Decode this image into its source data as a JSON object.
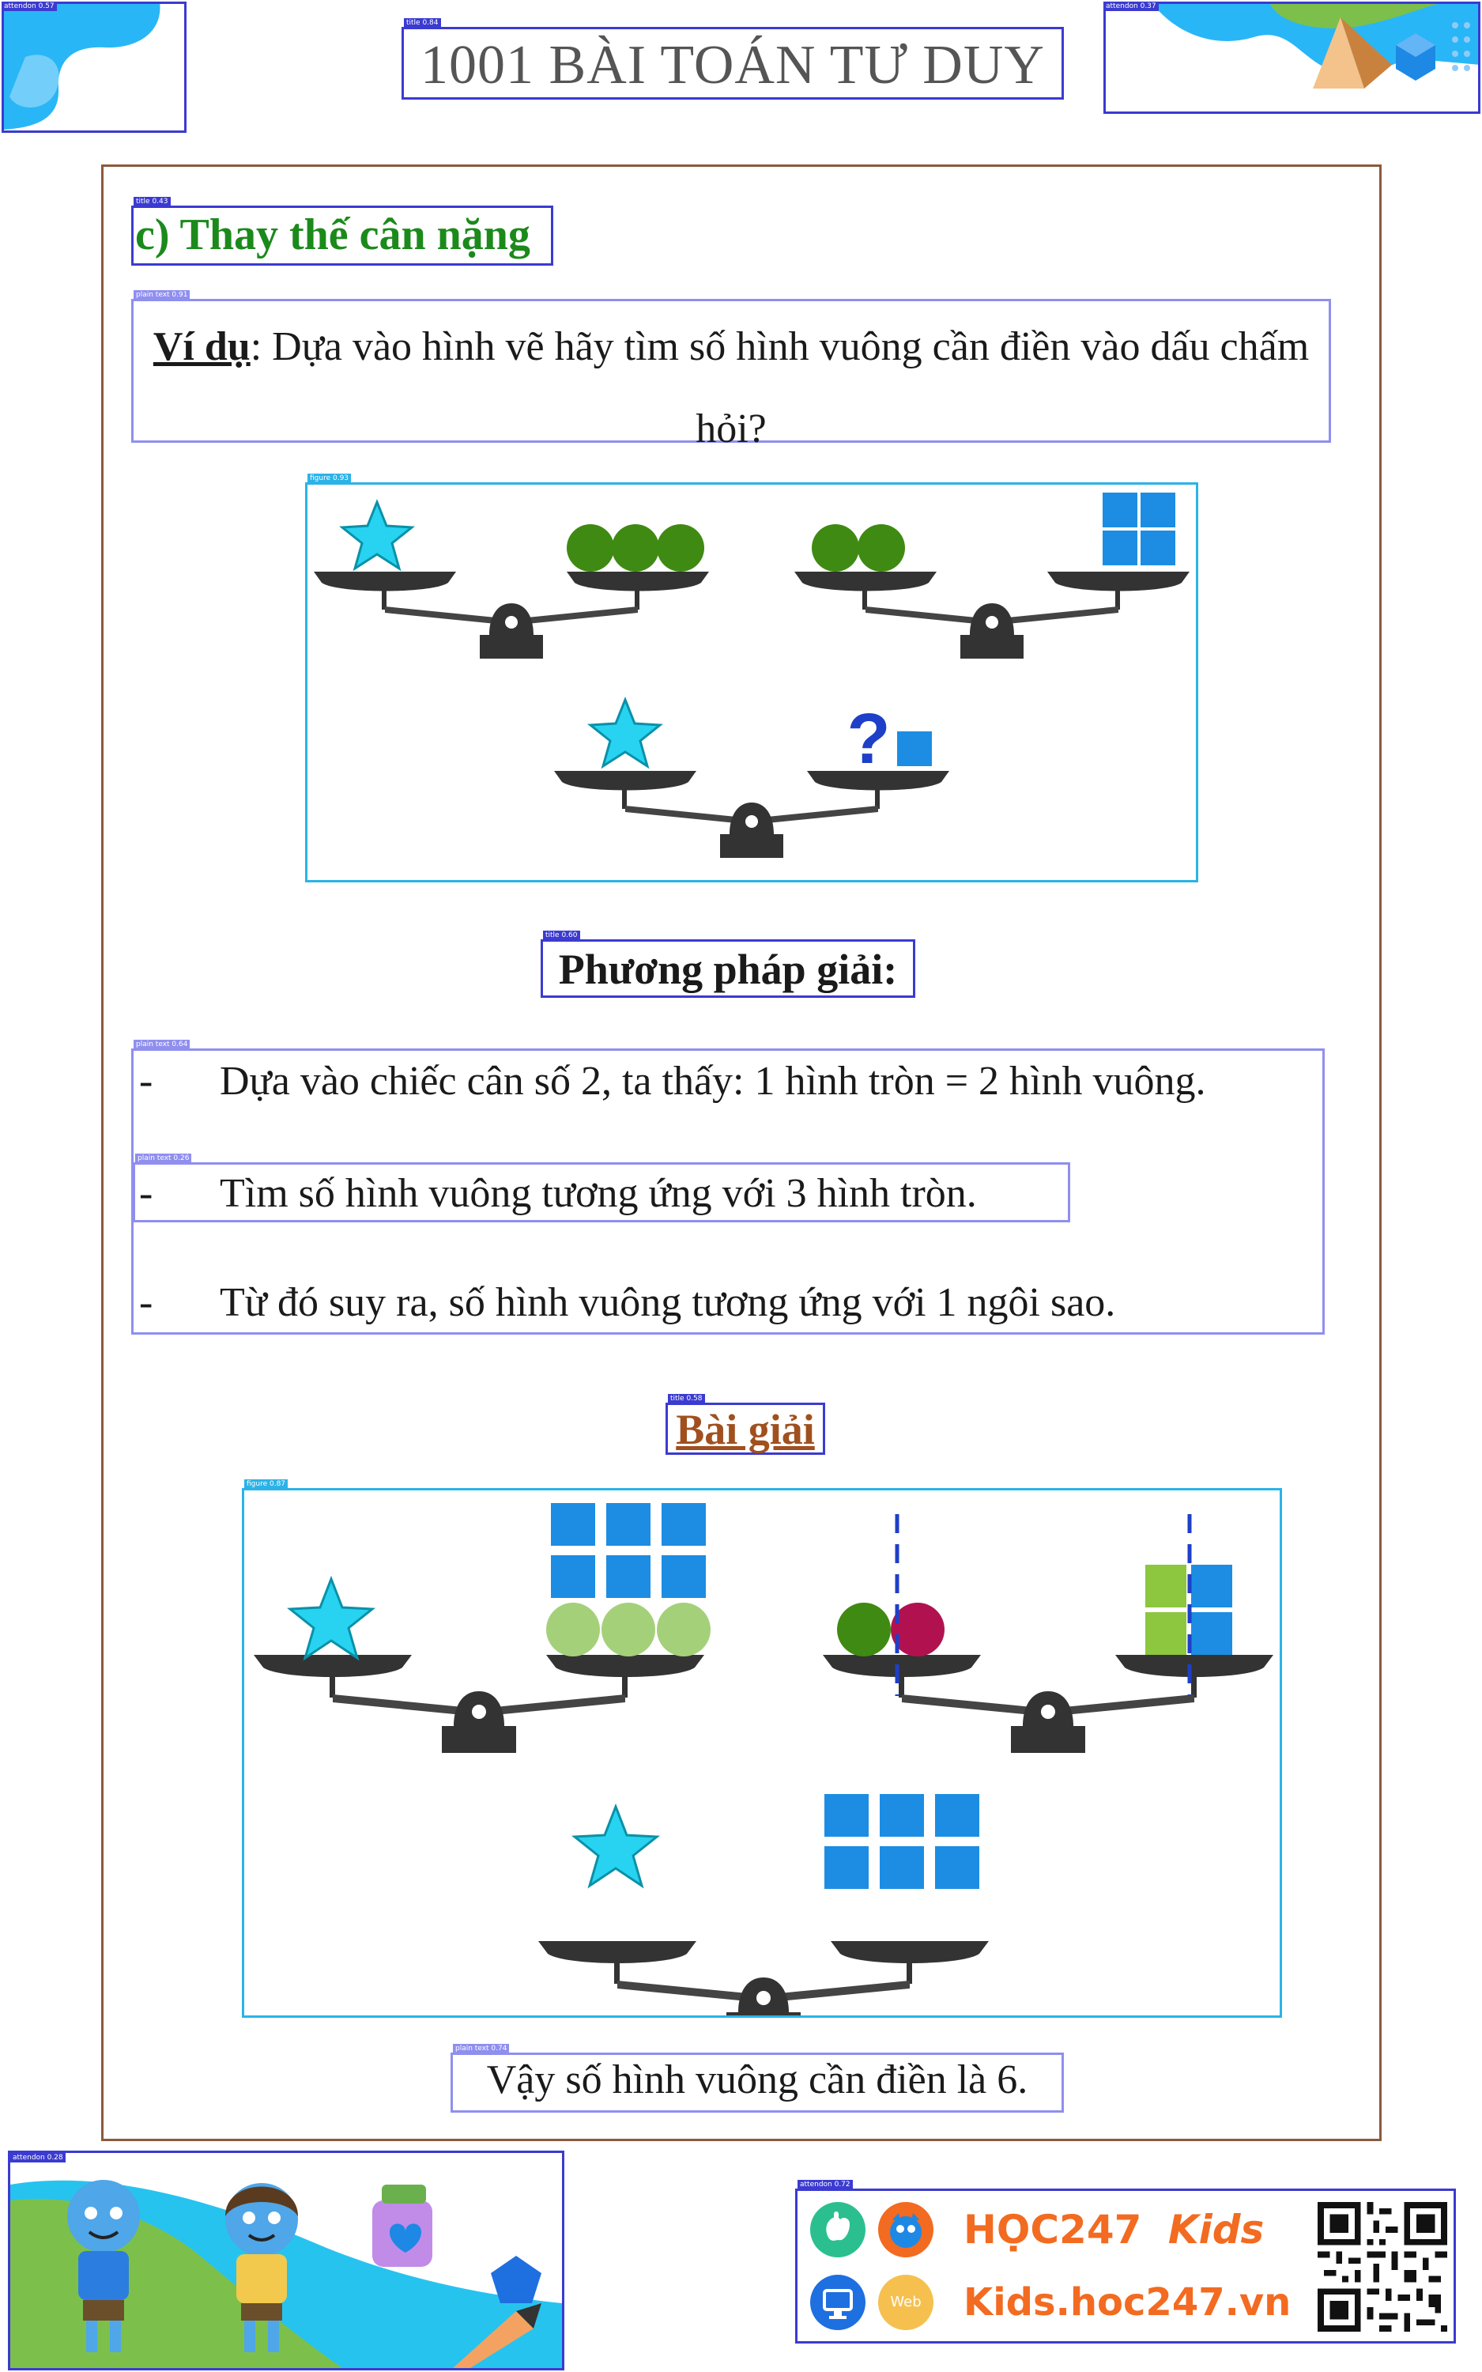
{
  "header": {
    "title": "1001 BÀI TOÁN TƯ DUY",
    "tags": {
      "left": "attendon 0.57",
      "title": "title 0.84",
      "right": "attendon 0.37"
    }
  },
  "section": {
    "title": "c) Thay thế cân nặng",
    "title_tag": "title 0.43",
    "example_label": "Ví dụ",
    "example_text": ": Dựa vào hình vẽ hãy tìm số hình vuông cần điền vào dấu chấm hỏi?",
    "example_tag": "plain text 0.91",
    "figure1_tag": "figure 0.93"
  },
  "method": {
    "title": "Phương pháp giải:",
    "title_tag": "title 0.60",
    "list_tag": "plain text 0.64",
    "item_tag": "plain text 0.26",
    "items": [
      {
        "dash": "-",
        "text": "Dựa vào chiếc cân số 2, ta thấy: 1 hình tròn = 2 hình vuông."
      },
      {
        "dash": "-",
        "text": "Tìm số hình vuông tương ứng với 3 hình tròn."
      },
      {
        "dash": "-",
        "text": "Từ đó suy ra, số hình vuông tương ứng với 1 ngôi sao."
      }
    ]
  },
  "solution": {
    "title": "Bài giải",
    "title_tag": "title 0.58",
    "figure2_tag": "figure 0.87",
    "answer": "Vậy số hình vuông cần điền là 6.",
    "answer_tag": "plain text 0.74"
  },
  "footer": {
    "left_tag": "attendon 0.28",
    "right_tag": "attendon 0.72",
    "brand": "HỌC247",
    "brand_kids": "Kids",
    "url": "Kids.hoc247.vn",
    "web_label": "Web"
  },
  "colors": {
    "green_title": "#1b8a1b",
    "brown_title": "#a0501e",
    "circle_green": "#3f8a12",
    "circle_light": "#a5d07a",
    "circle_red": "#b1124f",
    "square_blue": "#1c8de3",
    "square_green": "#8dc63f",
    "star": "#27d3f0",
    "scale": "#333333"
  }
}
